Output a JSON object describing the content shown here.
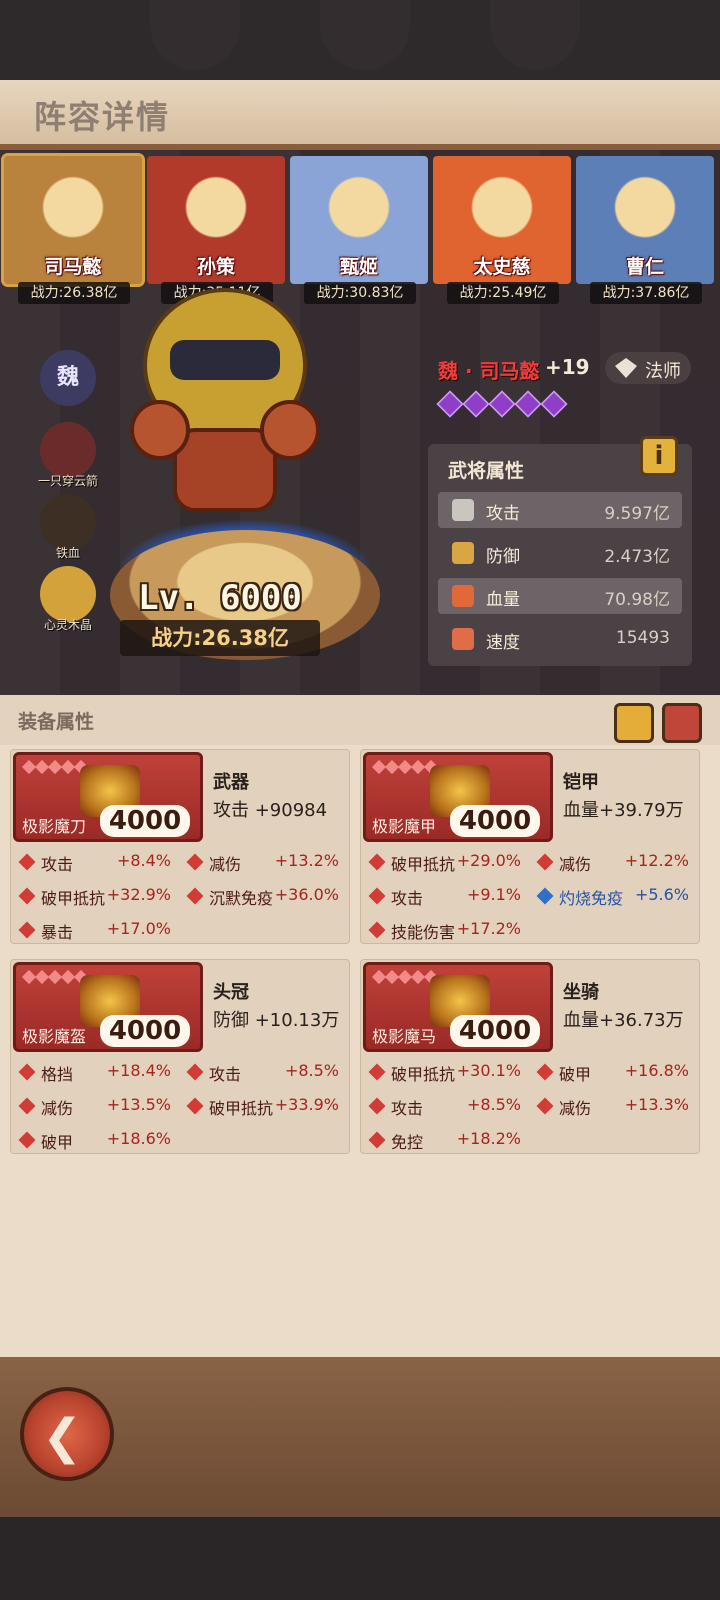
{
  "page": {
    "title": "阵容详情"
  },
  "team": [
    {
      "name": "司马懿",
      "power": "战力:26.38亿",
      "bg": "#b9823d",
      "active": true
    },
    {
      "name": "孙策",
      "power": "战力:35.11亿",
      "bg": "#b23a2b",
      "active": false
    },
    {
      "name": "甄姬",
      "power": "战力:30.83亿",
      "bg": "#8aa4d8",
      "active": false
    },
    {
      "name": "太史慈",
      "power": "战力:25.49亿",
      "bg": "#e0642f",
      "active": false
    },
    {
      "name": "曹仁",
      "power": "战力:37.86亿",
      "bg": "#5c7fb8",
      "active": false
    }
  ],
  "side": [
    {
      "label": "",
      "badge": "魏"
    },
    {
      "label": "一只穿云箭"
    },
    {
      "label": "铁血"
    },
    {
      "label": "心灵木晶"
    }
  ],
  "hero": {
    "level": "Lv. 6000",
    "power": "战力:26.38亿",
    "name": "魏 · 司马懿",
    "plus": "+19",
    "class": "法师",
    "stars": 5
  },
  "attributes": {
    "title": "武将属性",
    "info_label": "i",
    "rows": [
      {
        "key": "攻击",
        "value": "9.597亿",
        "icon": "sword-icon",
        "color": "#c9c6bf"
      },
      {
        "key": "防御",
        "value": "2.473亿",
        "icon": "shield-icon",
        "color": "#d9a644"
      },
      {
        "key": "血量",
        "value": "70.98亿",
        "icon": "crystal-icon",
        "color": "#e0693a"
      },
      {
        "key": "速度",
        "value": "15493",
        "icon": "boot-icon",
        "color": "#e06d48"
      }
    ]
  },
  "equipment": {
    "title": "装备属性",
    "items": [
      {
        "slot": "武器",
        "main": "攻击 +90984",
        "name": "极影魔刀",
        "level": "4000",
        "subs": [
          {
            "k": "攻击",
            "v": "+8.4%"
          },
          {
            "k": "减伤",
            "v": "+13.2%"
          },
          {
            "k": "破甲抵抗",
            "v": "+32.9%"
          },
          {
            "k": "沉默免疫",
            "v": "+36.0%"
          },
          {
            "k": "暴击",
            "v": "+17.0%"
          }
        ]
      },
      {
        "slot": "铠甲",
        "main": "血量+39.79万",
        "name": "极影魔甲",
        "level": "4000",
        "subs": [
          {
            "k": "破甲抵抗",
            "v": "+29.0%"
          },
          {
            "k": "减伤",
            "v": "+12.2%"
          },
          {
            "k": "攻击",
            "v": "+9.1%"
          },
          {
            "k": "灼烧免疫",
            "v": "+5.6%",
            "blue": true
          },
          {
            "k": "技能伤害",
            "v": "+17.2%"
          }
        ]
      },
      {
        "slot": "头冠",
        "main": "防御 +10.13万",
        "name": "极影魔盔",
        "level": "4000",
        "subs": [
          {
            "k": "格挡",
            "v": "+18.4%"
          },
          {
            "k": "攻击",
            "v": "+8.5%"
          },
          {
            "k": "减伤",
            "v": "+13.5%"
          },
          {
            "k": "破甲抵抗",
            "v": "+33.9%"
          },
          {
            "k": "破甲",
            "v": "+18.6%"
          }
        ]
      },
      {
        "slot": "坐骑",
        "main": "血量+36.73万",
        "name": "极影魔马",
        "level": "4000",
        "subs": [
          {
            "k": "破甲抵抗",
            "v": "+30.1%"
          },
          {
            "k": "破甲",
            "v": "+16.8%"
          },
          {
            "k": "攻击",
            "v": "+8.5%"
          },
          {
            "k": "减伤",
            "v": "+13.3%"
          },
          {
            "k": "免控",
            "v": "+18.2%"
          }
        ]
      }
    ]
  },
  "back_label": "back"
}
